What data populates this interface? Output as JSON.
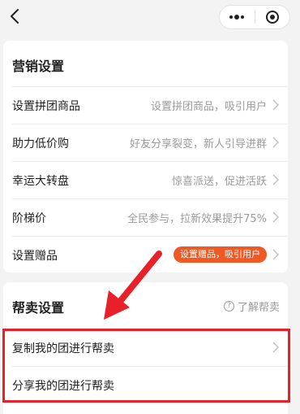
{
  "nav": {
    "back_icon": "chevron-left-icon",
    "more_icon": "more-dots-icon",
    "close_icon": "target-circle-icon"
  },
  "marketing": {
    "title": "营销设置",
    "rows": [
      {
        "label": "设置拼团商品",
        "desc": "设置拼团商品，吸引用户"
      },
      {
        "label": "助力低价购",
        "desc": "好友分享裂变，新人引导进群"
      },
      {
        "label": "幸运大转盘",
        "desc": "惊喜派送，促进活跃"
      },
      {
        "label": "阶梯价",
        "desc": "全民参与，拉新效果提升75%"
      },
      {
        "label": "设置赠品",
        "badge": "设置赠品，吸引用户"
      }
    ]
  },
  "resell": {
    "title": "帮卖设置",
    "help_label": "了解帮卖",
    "rows": [
      {
        "label": "复制我的团进行帮卖"
      },
      {
        "label": "分享我的团进行帮卖"
      }
    ]
  },
  "colors": {
    "accent": "#ef5a24",
    "annotation": "#e8202a"
  }
}
